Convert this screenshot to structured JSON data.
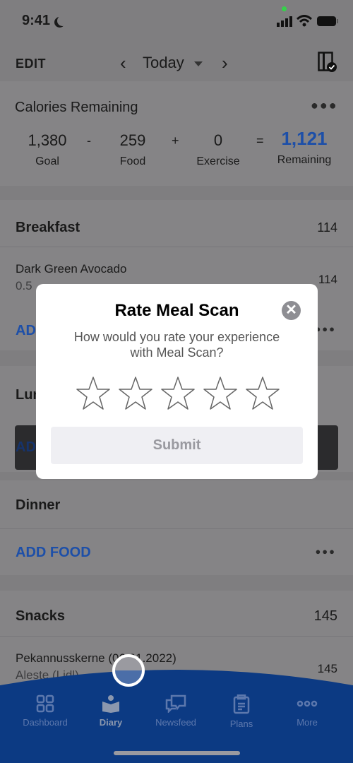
{
  "status_bar": {
    "time": "9:41"
  },
  "header": {
    "edit": "EDIT",
    "date": "Today"
  },
  "calories": {
    "title": "Calories Remaining",
    "goal": "1,380",
    "goal_label": "Goal",
    "minus": "-",
    "food": "259",
    "food_label": "Food",
    "plus": "+",
    "exercise": "0",
    "exercise_label": "Exercise",
    "equals": "=",
    "remaining": "1,121",
    "remaining_label": "Remaining"
  },
  "breakfast": {
    "title": "Breakfast",
    "total": "114",
    "items": [
      {
        "name": "Dark Green Avocado",
        "detail": "0.5",
        "cal": "114"
      }
    ],
    "add": "ADD FOOD"
  },
  "lunch": {
    "title": "Lunch",
    "add": "ADD FOOD"
  },
  "dinner": {
    "title": "Dinner",
    "add": "ADD FOOD"
  },
  "snacks": {
    "title": "Snacks",
    "total": "145",
    "items": [
      {
        "name": "Pekannusskerne (06.01.2022)",
        "detail": "Aleste (Lidl)",
        "cal": "145"
      }
    ]
  },
  "modal": {
    "title": "Rate Meal Scan",
    "question": "How would you rate your experience with Meal Scan?",
    "rating": 0,
    "max_rating": 5,
    "submit": "Submit"
  },
  "tabbar": {
    "items": [
      {
        "label": "Dashboard",
        "icon": "grid-icon"
      },
      {
        "label": "Diary",
        "icon": "book-reader-icon",
        "active": true
      },
      {
        "label": "Newsfeed",
        "icon": "chat-bubbles-icon"
      },
      {
        "label": "Plans",
        "icon": "clipboard-icon"
      },
      {
        "label": "More",
        "icon": "more-icon"
      }
    ]
  },
  "colors": {
    "accent": "#1d4fa8",
    "tabbar": "#0c3a83"
  }
}
